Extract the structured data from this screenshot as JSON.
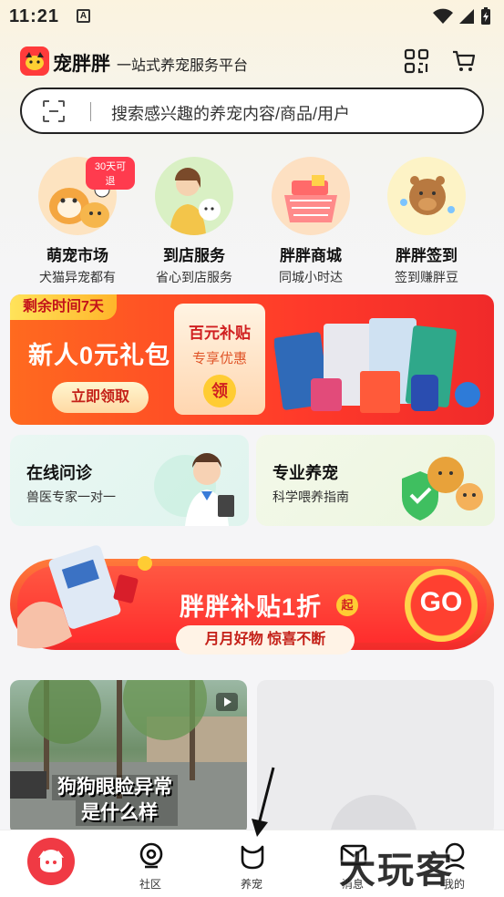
{
  "status": {
    "time": "11:21",
    "notif_letter": "A"
  },
  "header": {
    "brand": "宠胖胖",
    "slogan": "一站式养宠服务平台"
  },
  "search": {
    "placeholder": "搜索感兴趣的养宠内容/商品/用户"
  },
  "quick_entries": [
    {
      "title": "萌宠市场",
      "sub": "犬猫异宠都有",
      "badge": "30天可退"
    },
    {
      "title": "到店服务",
      "sub": "省心到店服务"
    },
    {
      "title": "胖胖商城",
      "sub": "同城小时达"
    },
    {
      "title": "胖胖签到",
      "sub": "签到赚胖豆"
    }
  ],
  "new_user_banner": {
    "time_left": "剩余时间7天",
    "title": "新人0元礼包",
    "button": "立即领取",
    "coupon_title": "百元补贴",
    "coupon_sub": "专享优惠",
    "coupon_action": "领"
  },
  "services": [
    {
      "title": "在线问诊",
      "sub": "兽医专家一对一"
    },
    {
      "title": "专业养宠",
      "sub": "科学喂养指南"
    }
  ],
  "promo": {
    "title": "胖胖补贴1折",
    "qi": "起",
    "sub": "月月好物 惊喜不断",
    "go": "GO"
  },
  "feed": {
    "video_caption_line1": "狗狗眼睑异常",
    "video_caption_line2": "是什么样"
  },
  "tabbar": {
    "community": "社区",
    "pets": "养宠",
    "messages": "消息",
    "mine": "我的"
  },
  "watermark": "大玩客",
  "colors": {
    "brand_red": "#f03a44",
    "banner_orange": "#ff6a1f",
    "text_dark": "#111111"
  }
}
